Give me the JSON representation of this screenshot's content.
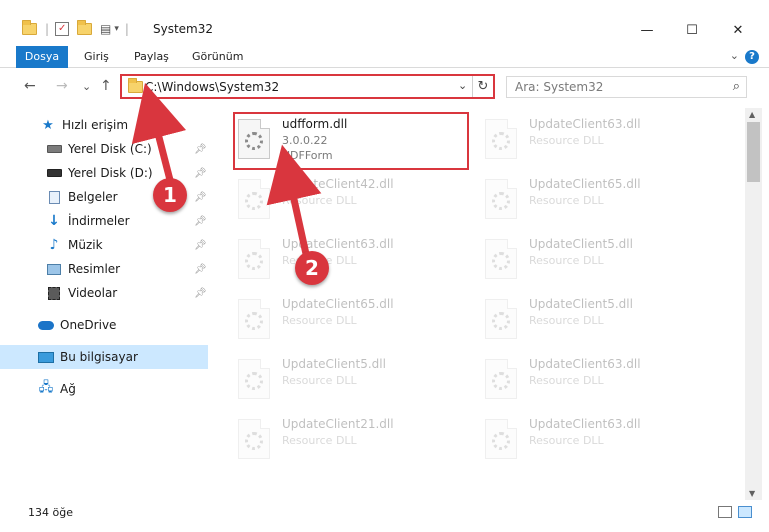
{
  "window": {
    "title": "System32",
    "minimize_glyph": "—",
    "maximize_glyph": "☐",
    "close_glyph": "✕"
  },
  "ribbon": {
    "tabs": [
      "Dosya",
      "Giriş",
      "Paylaş",
      "Görünüm"
    ],
    "help_glyph": "?",
    "collapse_glyph": "⌄"
  },
  "nav": {
    "back_glyph": "←",
    "forward_glyph": "→",
    "recent_glyph": "⌄",
    "up_glyph": "↑",
    "address": "C:\\Windows\\System32",
    "dropdown_glyph": "⌄",
    "refresh_glyph": "↻",
    "search_placeholder": "Ara: System32",
    "search_glyph": "⌕"
  },
  "sidebar": {
    "quick_access": "Hızlı erişim",
    "items": [
      {
        "label": "Yerel Disk (C:)",
        "icon": "disk-icon"
      },
      {
        "label": "Yerel Disk (D:)",
        "icon": "disk-icon"
      },
      {
        "label": "Belgeler",
        "icon": "documents-icon"
      },
      {
        "label": "İndirmeler",
        "icon": "downloads-icon"
      },
      {
        "label": "Müzik",
        "icon": "music-icon"
      },
      {
        "label": "Resimler",
        "icon": "pictures-icon"
      },
      {
        "label": "Videolar",
        "icon": "videos-icon"
      }
    ],
    "onedrive": "OneDrive",
    "this_pc": "Bu bilgisayar",
    "network": "Ağ"
  },
  "files": {
    "highlighted": {
      "name": "udfform.dll",
      "version": "3.0.0.22",
      "description": "UDFForm"
    },
    "left_column": [
      {
        "name": "UpdateClient42.dll",
        "type": "Resource DLL"
      },
      {
        "name": "UpdateClient63.dll",
        "type": "Resource DLL"
      },
      {
        "name": "UpdateClient65.dll",
        "type": "Resource DLL"
      },
      {
        "name": "UpdateClient5.dll",
        "type": "Resource DLL"
      },
      {
        "name": "UpdateClient21.dll",
        "type": "Resource DLL"
      }
    ],
    "right_column": [
      {
        "name": "UpdateClient63.dll",
        "type": "Resource DLL"
      },
      {
        "name": "UpdateClient65.dll",
        "type": "Resource DLL"
      },
      {
        "name": "UpdateClient5.dll",
        "type": "Resource DLL"
      },
      {
        "name": "UpdateClient5.dll",
        "type": "Resource DLL"
      },
      {
        "name": "UpdateClient63.dll",
        "type": "Resource DLL"
      },
      {
        "name": "UpdateClient63.dll",
        "type": "Resource DLL"
      }
    ]
  },
  "status": {
    "item_count": "134 öğe"
  },
  "annotations": {
    "marker_1": "1",
    "marker_2": "2",
    "color": "#d9363e"
  },
  "colors": {
    "accent": "#1979ca",
    "selected_bg": "#cce8ff",
    "highlight": "#d9363e"
  }
}
